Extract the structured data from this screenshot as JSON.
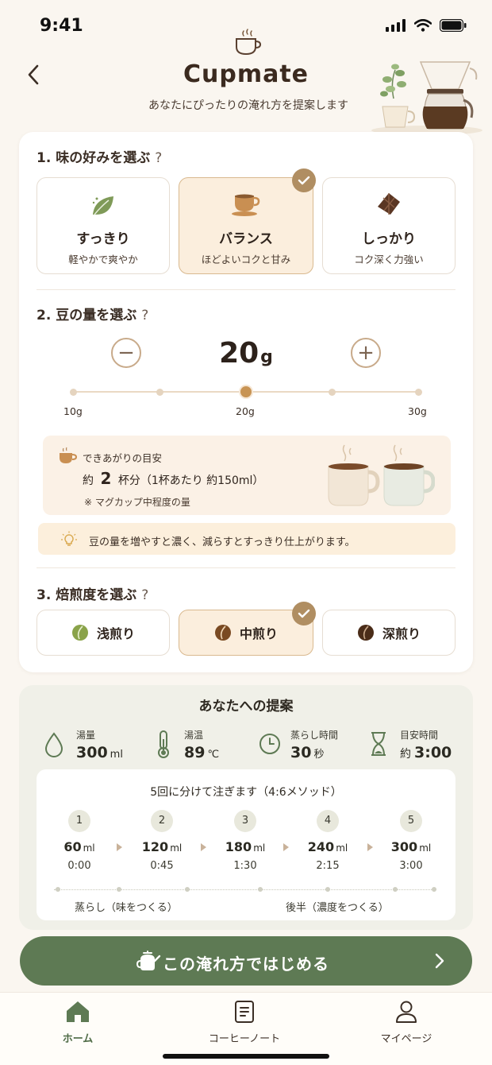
{
  "status": {
    "time": "9:41"
  },
  "header": {
    "title": "Cupmate",
    "subtitle": "あなたにぴったりの淹れ方を提案します"
  },
  "taste": {
    "title": "1. 味の好みを選ぶ",
    "help": "?",
    "options": [
      {
        "label": "すっきり",
        "desc": "軽やかで爽やか",
        "icon": "leaf-icon",
        "selected": false
      },
      {
        "label": "バランス",
        "desc": "ほどよいコクと甘み",
        "icon": "coffee-cup-icon",
        "selected": true
      },
      {
        "label": "しっかり",
        "desc": "コク深く力強い",
        "icon": "chocolate-icon",
        "selected": false
      }
    ]
  },
  "beans": {
    "title": "2. 豆の量を選ぶ",
    "help": "?",
    "value": "20",
    "unit": "g",
    "minus": "−",
    "plus": "+",
    "slider": {
      "min_label": "10g",
      "mid_label": "20g",
      "max_label": "30g",
      "min": 10,
      "max": 30,
      "value": 20
    },
    "result": {
      "label": "できあがりの目安",
      "prefix": "約",
      "cups": "2",
      "cups_unit": "杯分（1杯あたり 約150ml）",
      "note": "※ マグカップ中程度の量"
    },
    "tip": "豆の量を増やすと濃く、減らすとすっきり仕上がります。"
  },
  "roast": {
    "title": "3. 焙煎度を選ぶ",
    "help": "?",
    "options": [
      {
        "label": "浅煎り",
        "selected": false,
        "color": "#8aa34a"
      },
      {
        "label": "中煎り",
        "selected": true,
        "color": "#7a4a22"
      },
      {
        "label": "深煎り",
        "selected": false,
        "color": "#4a2c18"
      }
    ]
  },
  "suggestion": {
    "title": "あなたへの提案",
    "metrics": [
      {
        "label": "湯量",
        "value": "300",
        "unit": "ml",
        "prefix": "",
        "icon": "water-drop-icon"
      },
      {
        "label": "湯温",
        "value": "89",
        "unit": "℃",
        "prefix": "",
        "icon": "thermometer-icon"
      },
      {
        "label": "蒸らし時間",
        "value": "30",
        "unit": "秒",
        "prefix": "",
        "icon": "clock-icon"
      },
      {
        "label": "目安時間",
        "value": "3:00",
        "unit": "",
        "prefix": "約",
        "icon": "hourglass-icon"
      }
    ],
    "method": "5回に分けて注ぎます（4:6メソッド）",
    "steps": [
      {
        "n": "1",
        "ml": "60",
        "time": "0:00"
      },
      {
        "n": "2",
        "ml": "120",
        "time": "0:45"
      },
      {
        "n": "3",
        "ml": "180",
        "time": "1:30"
      },
      {
        "n": "4",
        "ml": "240",
        "time": "2:15"
      },
      {
        "n": "5",
        "ml": "300",
        "time": "3:00"
      }
    ],
    "ml_unit": "ml",
    "phases": [
      "蒸らし（味をつくる）",
      "後半（濃度をつくる）"
    ]
  },
  "cta": {
    "label": "この淹れ方ではじめる"
  },
  "tabs": [
    {
      "label": "ホーム",
      "icon": "home-icon",
      "active": true
    },
    {
      "label": "コーヒーノート",
      "icon": "notebook-icon",
      "active": false
    },
    {
      "label": "マイページ",
      "icon": "user-icon",
      "active": false
    }
  ],
  "colors": {
    "accent": "#5e7a54",
    "brown": "#b08e62",
    "selected_bg": "#fbeedd"
  }
}
